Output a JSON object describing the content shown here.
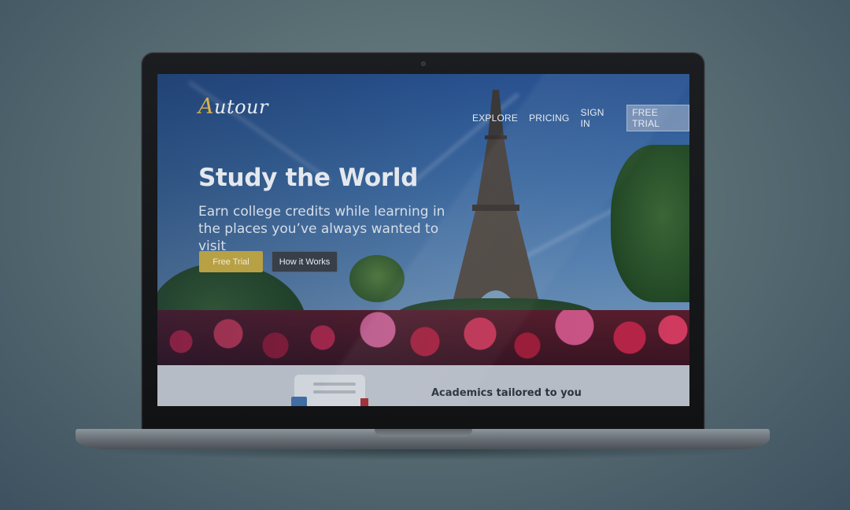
{
  "brand": {
    "logo_first_letter": "A",
    "logo_rest": "utour",
    "accent_color": "#d9b24a"
  },
  "nav": {
    "items": [
      {
        "label": "EXPLORE"
      },
      {
        "label": "PRICING"
      },
      {
        "label": "SIGN IN"
      }
    ],
    "cta_label": "FREE TRIAL"
  },
  "hero": {
    "headline": "Study the World",
    "subline": "Earn college credits while learning in the places you’ve always wanted to visit",
    "primary_button": "Free Trial",
    "secondary_button": "How it Works",
    "primary_color": "#b8a045",
    "secondary_color": "#393f48"
  },
  "section": {
    "heading": "Academics tailored to you"
  }
}
